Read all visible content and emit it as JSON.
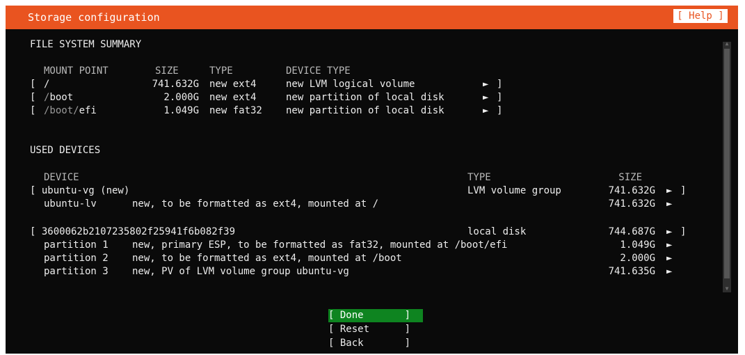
{
  "header": {
    "title": "Storage configuration",
    "help_label": "[ Help ]"
  },
  "fs_summary": {
    "heading": "FILE SYSTEM SUMMARY",
    "columns": {
      "mount": "MOUNT POINT",
      "size": "SIZE",
      "type": "TYPE",
      "device_type": "DEVICE TYPE"
    },
    "rows": [
      {
        "bracket": "[",
        "mount_dim": "",
        "mount_rest": "/",
        "size": "741.632G",
        "type": "new ext4",
        "device_type": "new LVM logical volume",
        "arrow": "►",
        "close": "]"
      },
      {
        "bracket": "[",
        "mount_dim": "/",
        "mount_rest": "boot",
        "size": "2.000G",
        "type": "new ext4",
        "device_type": "new partition of local disk",
        "arrow": "►",
        "close": "]"
      },
      {
        "bracket": "[",
        "mount_dim": "/boot/",
        "mount_rest": "efi",
        "size": "1.049G",
        "type": "new fat32",
        "device_type": "new partition of local disk",
        "arrow": "►",
        "close": "]"
      }
    ]
  },
  "used_devices": {
    "heading": "USED DEVICES",
    "columns": {
      "device": "DEVICE",
      "type": "TYPE",
      "size": "SIZE"
    },
    "groups": [
      {
        "device": "[ ubuntu-vg (new)",
        "type": "LVM volume group",
        "size": "741.632G",
        "arrow": "►",
        "close": "]",
        "children": [
          {
            "name": "ubuntu-lv",
            "desc": "new, to be formatted as ext4, mounted at /",
            "size": "741.632G",
            "arrow": "►"
          }
        ]
      },
      {
        "device": "[ 3600062b2107235802f25941f6b082f39",
        "type": "local disk",
        "size": "744.687G",
        "arrow": "►",
        "close": "]",
        "children": [
          {
            "name": "partition 1",
            "desc": "new, primary ESP, to be formatted as fat32, mounted at /boot/efi",
            "size": "1.049G",
            "arrow": "►"
          },
          {
            "name": "partition 2",
            "desc": "new, to be formatted as ext4, mounted at /boot",
            "size": "2.000G",
            "arrow": "►"
          },
          {
            "name": "partition 3",
            "desc": "new, PV of LVM volume group ubuntu-vg",
            "size": "741.635G",
            "arrow": "►"
          }
        ]
      }
    ]
  },
  "buttons": [
    {
      "label": "[ Done       ]",
      "selected": true
    },
    {
      "label": "[ Reset      ]",
      "selected": false
    },
    {
      "label": "[ Back       ]",
      "selected": false
    }
  ],
  "scrollbar": {
    "up_glyph": "▲",
    "down_glyph": "▼"
  },
  "colors": {
    "title_bar": "#e95420",
    "background": "#0a0a0a",
    "selected_button": "#0e8420",
    "text": "#ededed"
  }
}
